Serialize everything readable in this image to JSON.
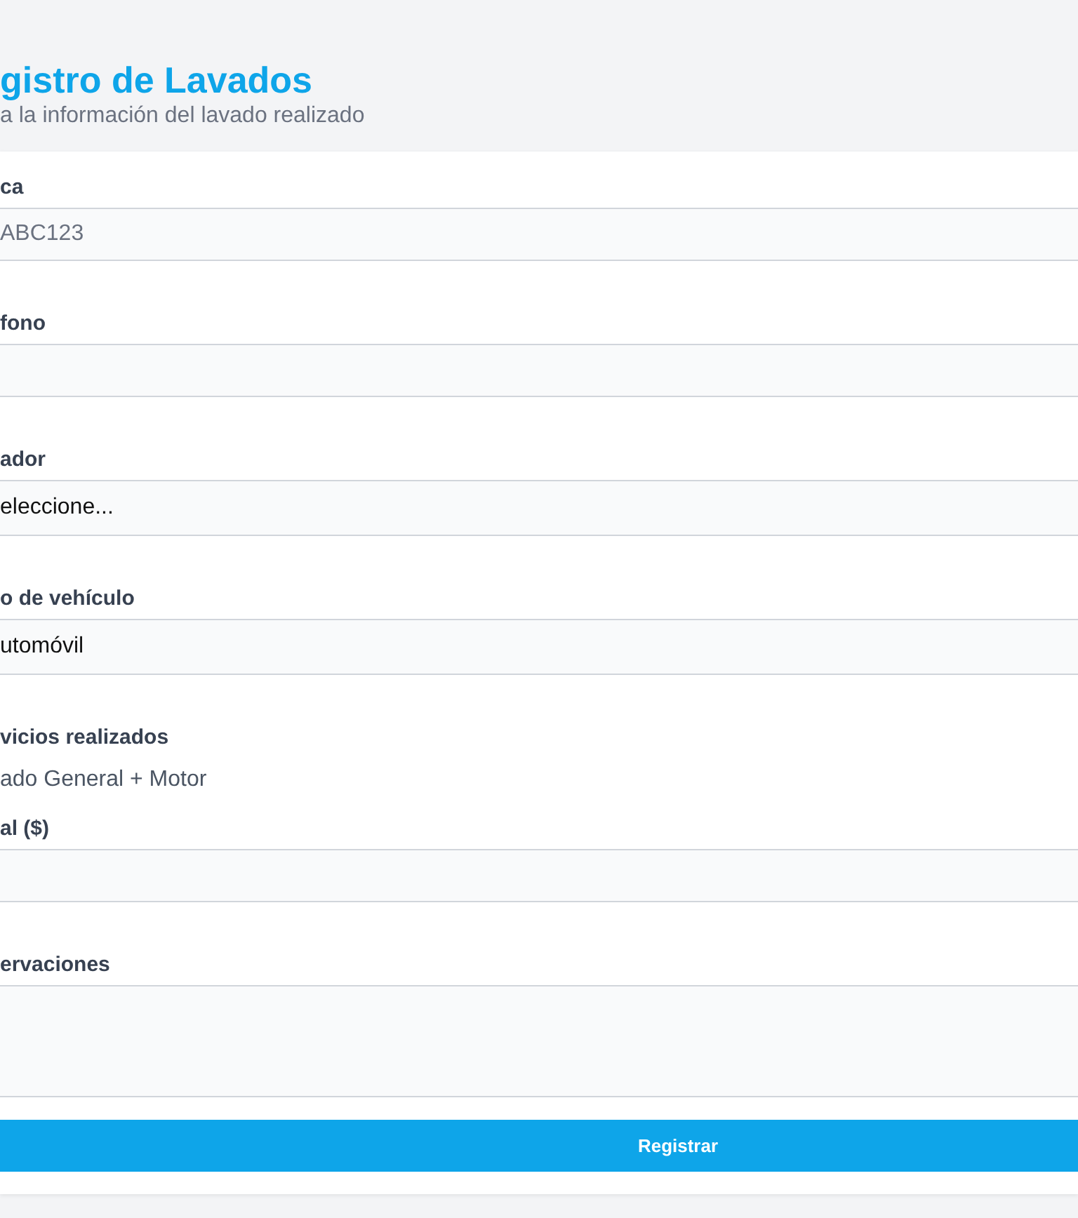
{
  "header": {
    "title": "gistro de Lavados",
    "subtitle": "a la información del lavado realizado"
  },
  "fields": [
    {
      "kind": "input",
      "label": "ca",
      "placeholder": "ABC123"
    },
    {
      "kind": "input",
      "label": "fono"
    },
    {
      "kind": "select",
      "label": "ador",
      "value": "eleccione..."
    },
    {
      "kind": "select",
      "label": "o de vehículo",
      "value": "utomóvil"
    },
    {
      "kind": "text",
      "label": "vicios realizados",
      "value": "ado General + Motor"
    },
    {
      "kind": "input",
      "label": "al ($)"
    },
    {
      "kind": "textarea",
      "label": "ervaciones"
    }
  ],
  "submit": {
    "label": "Registrar"
  }
}
